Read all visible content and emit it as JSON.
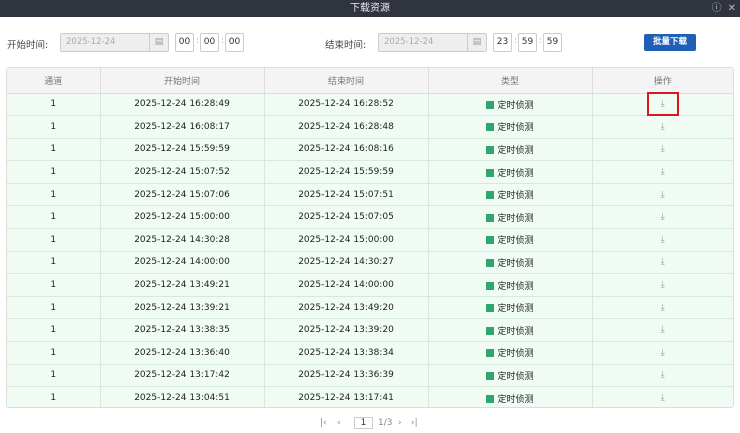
{
  "window": {
    "title": "下载资源",
    "help_icon": "help-icon",
    "close_icon": "close-icon"
  },
  "filter": {
    "start_label": "开始时间:",
    "start_date": "2025-12-24",
    "start_h": "00",
    "start_m": "00",
    "start_s": "00",
    "end_label": "结束时间:",
    "end_date": "2025-12-24",
    "end_h": "23",
    "end_m": "59",
    "end_s": "59",
    "batch_label": "批量下载",
    "colon": ":"
  },
  "table": {
    "headers": [
      "通道",
      "开始时间",
      "结束时间",
      "类型",
      "操作"
    ],
    "rows": [
      [
        "1",
        "2025-12-24 16:28:49",
        "2025-12-24 16:28:52",
        "定时侦测"
      ],
      [
        "1",
        "2025-12-24 16:08:17",
        "2025-12-24 16:28:48",
        "定时侦测"
      ],
      [
        "1",
        "2025-12-24 15:59:59",
        "2025-12-24 16:08:16",
        "定时侦测"
      ],
      [
        "1",
        "2025-12-24 15:07:52",
        "2025-12-24 15:59:59",
        "定时侦测"
      ],
      [
        "1",
        "2025-12-24 15:07:06",
        "2025-12-24 15:07:51",
        "定时侦测"
      ],
      [
        "1",
        "2025-12-24 15:00:00",
        "2025-12-24 15:07:05",
        "定时侦测"
      ],
      [
        "1",
        "2025-12-24 14:30:28",
        "2025-12-24 15:00:00",
        "定时侦测"
      ],
      [
        "1",
        "2025-12-24 14:00:00",
        "2025-12-24 14:30:27",
        "定时侦测"
      ],
      [
        "1",
        "2025-12-24 13:49:21",
        "2025-12-24 14:00:00",
        "定时侦测"
      ],
      [
        "1",
        "2025-12-24 13:39:21",
        "2025-12-24 13:49:20",
        "定时侦测"
      ],
      [
        "1",
        "2025-12-24 13:38:35",
        "2025-12-24 13:39:20",
        "定时侦测"
      ],
      [
        "1",
        "2025-12-24 13:36:40",
        "2025-12-24 13:38:34",
        "定时侦测"
      ],
      [
        "1",
        "2025-12-24 13:17:42",
        "2025-12-24 13:36:39",
        "定时侦测"
      ],
      [
        "1",
        "2025-12-24 13:04:51",
        "2025-12-24 13:17:41",
        "定时侦测"
      ]
    ],
    "type_color": "#2fa66e",
    "highlight_color": "#e0141e"
  },
  "pager": {
    "current": "1",
    "total": "1/3"
  }
}
